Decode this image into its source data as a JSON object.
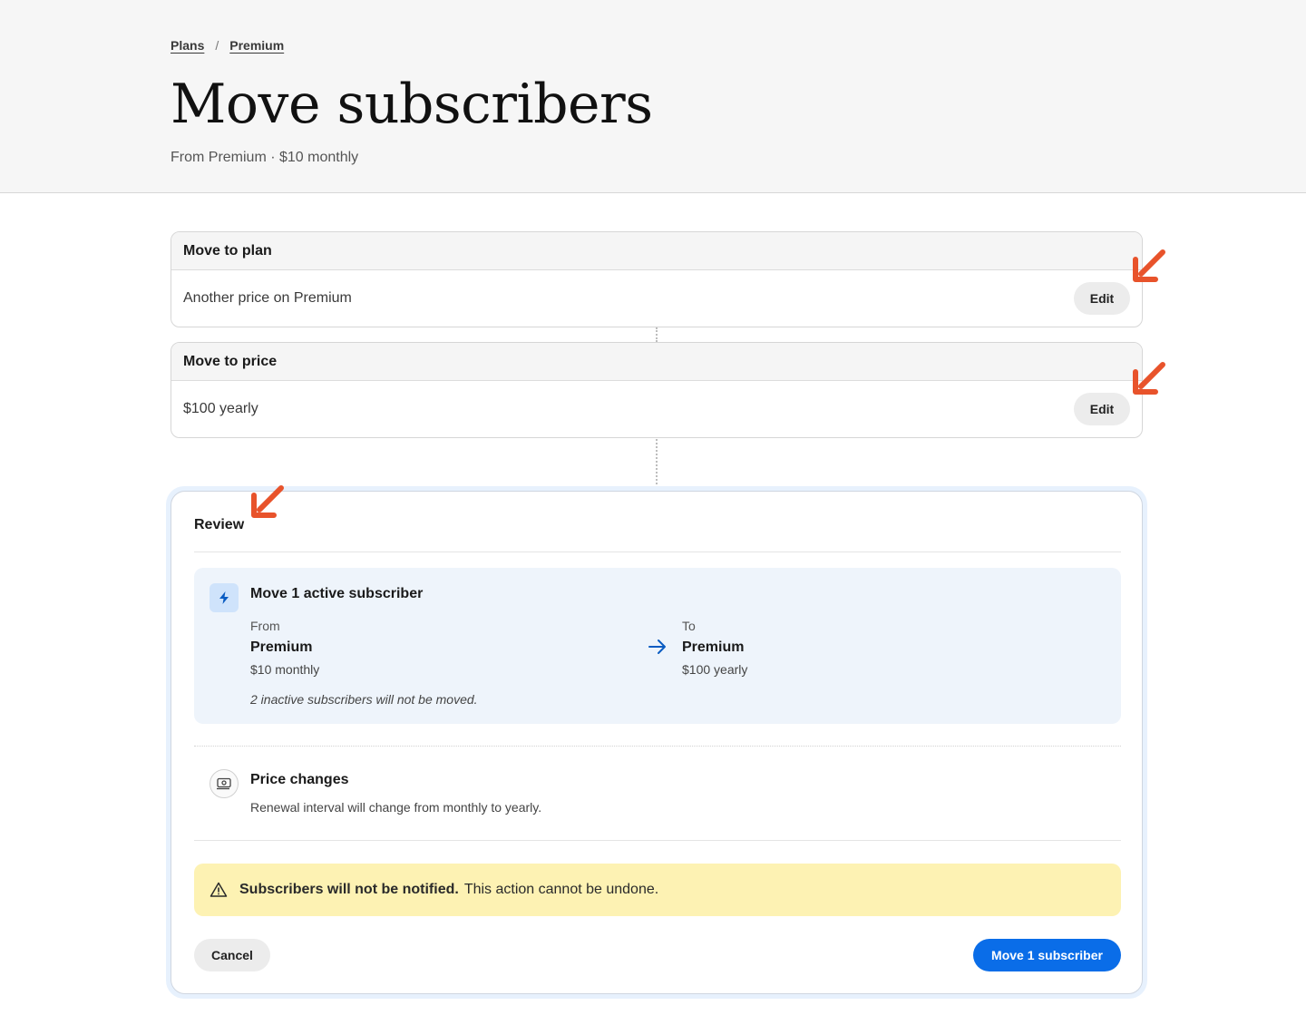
{
  "breadcrumb": {
    "items": [
      "Plans",
      "Premium"
    ],
    "separator": "/"
  },
  "page": {
    "title": "Move subscribers",
    "subtitle": "From Premium · $10 monthly"
  },
  "steps": [
    {
      "heading": "Move to plan",
      "value": "Another price on Premium",
      "action": "Edit"
    },
    {
      "heading": "Move to price",
      "value": "$100 yearly",
      "action": "Edit"
    }
  ],
  "review": {
    "title": "Review",
    "move": {
      "title": "Move 1 active subscriber",
      "from": {
        "label": "From",
        "plan": "Premium",
        "price": "$10 monthly"
      },
      "to": {
        "label": "To",
        "plan": "Premium",
        "price": "$100 yearly"
      },
      "note": "2 inactive subscribers will not be moved."
    },
    "price_changes": {
      "title": "Price changes",
      "description": "Renewal interval will change from monthly to yearly."
    },
    "warning": {
      "bold": "Subscribers will not be notified.",
      "text": "This action cannot be undone."
    },
    "cancel_label": "Cancel",
    "confirm_label": "Move 1 subscriber"
  },
  "colors": {
    "accent": "#0a6de8",
    "annotation_arrow": "#e8532b",
    "warning_bg": "#fdf2b3",
    "info_bg": "#eef4fb"
  },
  "icons": [
    "bolt-icon",
    "arrow-right-icon",
    "money-icon",
    "warning-triangle-icon",
    "annotation-arrow-icon"
  ]
}
